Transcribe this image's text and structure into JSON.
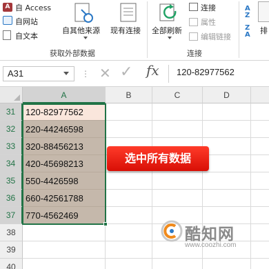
{
  "ribbon": {
    "from_access": "自 Access",
    "from_web": "自网站",
    "from_text": "自文本",
    "from_other_sources": "自其他来源",
    "existing_connections": "现有连接",
    "refresh_all": "全部刷新",
    "connections": "连接",
    "properties": "属性",
    "edit_links": "编辑链接",
    "sort_partial": "排",
    "group_get_external_data": "获取外部数据",
    "group_connections": "连接"
  },
  "formula_bar": {
    "name_box": "A31",
    "fx_label": "fx",
    "content": "120-82977562"
  },
  "grid": {
    "columns": [
      "A",
      "B",
      "C",
      "D"
    ],
    "selected_column": "A",
    "rows": [
      {
        "num": "31",
        "a": "120-82977562"
      },
      {
        "num": "32",
        "a": "220-44246598"
      },
      {
        "num": "33",
        "a": "320-88456213"
      },
      {
        "num": "34",
        "a": "420-45698213"
      },
      {
        "num": "35",
        "a": "550-4426598"
      },
      {
        "num": "36",
        "a": "660-42561788"
      },
      {
        "num": "37",
        "a": "770-4562469"
      },
      {
        "num": "38",
        "a": ""
      },
      {
        "num": "39",
        "a": ""
      },
      {
        "num": "40",
        "a": ""
      }
    ]
  },
  "callout": {
    "text": "选中所有数据"
  },
  "watermark": {
    "brand": "酷知网",
    "url": "www.coozhi.com"
  },
  "colors": {
    "excel_green": "#217346",
    "selection_fill": "#c5b8ab",
    "active_cell_fill": "#fae6dc",
    "callout_red": "#e8160b"
  }
}
